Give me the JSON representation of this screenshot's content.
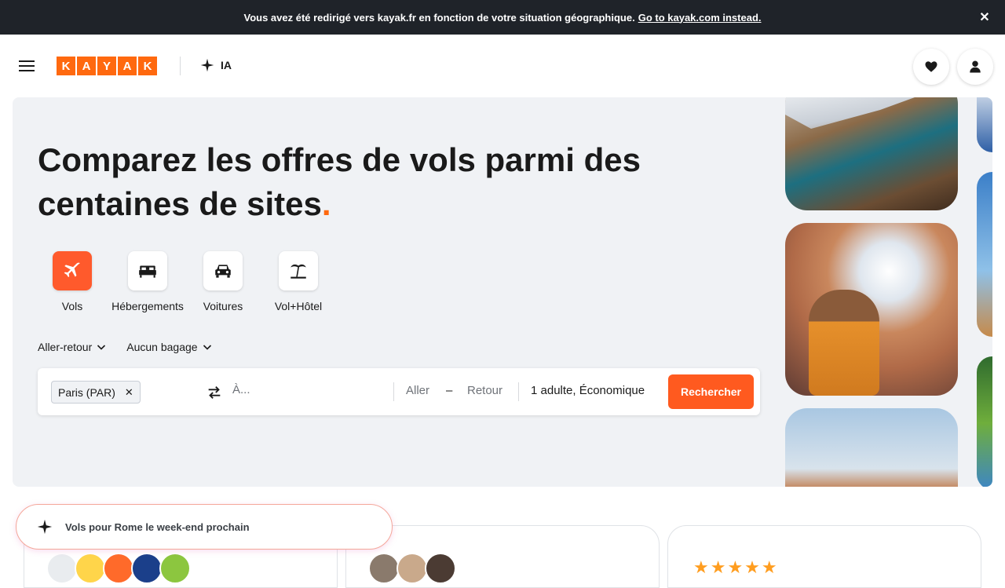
{
  "banner": {
    "message": "Vous avez été redirigé vers kayak.fr en fonction de votre situation géographique.",
    "link": "Go to kayak.com instead.",
    "close_icon": "close-icon"
  },
  "header": {
    "logo_letters": [
      "K",
      "A",
      "Y",
      "A",
      "K"
    ],
    "ai_label": "IA",
    "brand_color": "#ff690f"
  },
  "hero": {
    "title": "Comparez les offres de vols parmi des centaines de sites",
    "title_dot": ".",
    "categories": [
      {
        "label": "Vols",
        "icon": "plane-icon",
        "active": true
      },
      {
        "label": "Hébergements",
        "icon": "bed-icon",
        "active": false
      },
      {
        "label": "Voitures",
        "icon": "car-icon",
        "active": false
      },
      {
        "label": "Vol+Hôtel",
        "icon": "beach-icon",
        "active": false
      }
    ],
    "filters": {
      "trip_type": "Aller-retour",
      "baggage": "Aucun bagage"
    }
  },
  "search": {
    "origin_chip": "Paris (PAR)",
    "destination_placeholder": "À...",
    "depart": "Aller",
    "date_dash": "–",
    "return": "Retour",
    "passengers": "1 adulte, Économique",
    "button": "Rechercher"
  },
  "ai_prompt": {
    "text": "Vols pour Rome le week-end prochain"
  },
  "rating": {
    "stars": "★★★★★"
  }
}
